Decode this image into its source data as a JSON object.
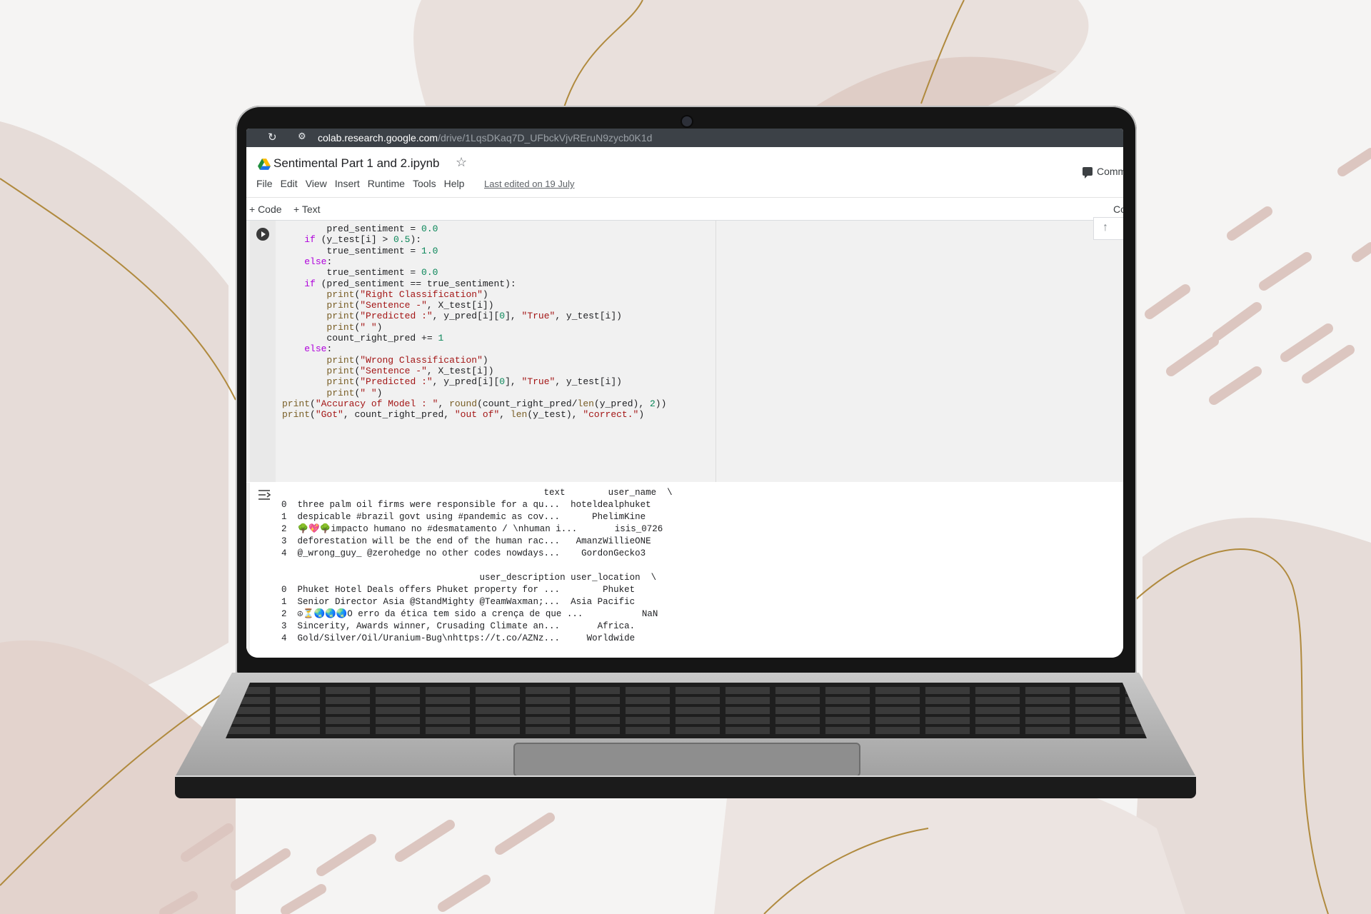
{
  "browser": {
    "url_host": "colab.research.google.com",
    "url_path": "/drive/1LqsDKaq7D_UFbckVjvREruN9zycb0K1d"
  },
  "notebook": {
    "title": "Sentimental Part 1 and 2.ipynb",
    "menu": [
      "File",
      "Edit",
      "View",
      "Insert",
      "Runtime",
      "Tools",
      "Help"
    ],
    "last_edited": "Last edited on 19 July",
    "comment_label": "Comm",
    "add_code": "+ Code",
    "add_text": "+ Text",
    "toolbar_right": "Co"
  },
  "code_cell": {
    "lines": [
      "        pred_sentiment = 0.0",
      "    if (y_test[i] > 0.5):",
      "        true_sentiment = 1.0",
      "    else:",
      "        true_sentiment = 0.0",
      "    if (pred_sentiment == true_sentiment):",
      "        print(\"Right Classification\")",
      "        print(\"Sentence -\", X_test[i])",
      "        print(\"Predicted :\", y_pred[i][0], \"True\", y_test[i])",
      "        print(\" \")",
      "        count_right_pred += 1",
      "    else:",
      "        print(\"Wrong Classification\")",
      "        print(\"Sentence -\", X_test[i])",
      "        print(\"Predicted :\", y_pred[i][0], \"True\", y_test[i])",
      "        print(\" \")",
      "print(\"Accuracy of Model : \", round(count_right_pred/len(y_pred), 2))",
      "print(\"Got\", count_right_pred, \"out of\", len(y_test), \"correct.\")"
    ]
  },
  "output": {
    "lines": [
      "                                                 text        user_name  \\",
      "0  three palm oil firms were responsible for a qu...  hoteldealphuket",
      "1  despicable #brazil govt using #pandemic as cov...      PhelimKine",
      "2  🌳💖🌳impacto humano no #desmatamento / \\nhuman i...       isis_0726",
      "3  deforestation will be the end of the human rac...   AmanzWillieONE",
      "4  @_wrong_guy_ @zerohedge no other codes nowdays...    GordonGecko3",
      "",
      "                                     user_description user_location  \\",
      "0  Phuket Hotel Deals offers Phuket property for ...        Phuket",
      "1  Senior Director Asia @StandMighty @TeamWaxman;...  Asia Pacific",
      "2  ☮⏳🌏🌏🌏O erro da ética tem sido a crença de que ...           NaN",
      "3  Sincerity, Awards winner, Crusading Climate an...       Africa.",
      "4  Gold/Silver/Oil/Uranium-Bug\\nhttps://t.co/AZNz...     Worldwide"
    ]
  },
  "colors": {
    "background": "#f5f4f3",
    "blob": "#dfcdc6",
    "line_accent": "#b08a3e",
    "keyword": "#af00db",
    "string": "#a31515",
    "number": "#098658",
    "function": "#795e26"
  }
}
